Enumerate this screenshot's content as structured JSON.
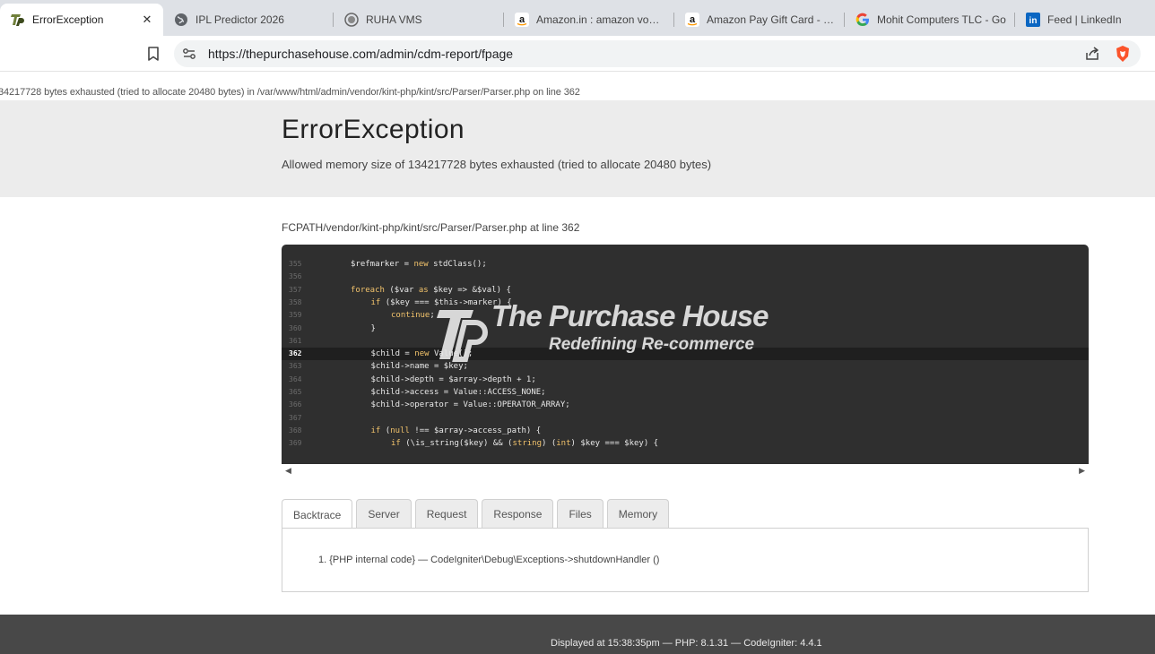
{
  "browser": {
    "tabs": [
      {
        "title": "ErrorException",
        "icon": "purchase-house-favicon-icon",
        "active": true
      },
      {
        "title": "IPL Predictor 2026",
        "icon": "globe-icon"
      },
      {
        "title": "RUHA VMS",
        "icon": "ruha-favicon-icon"
      },
      {
        "title": "Amazon.in : amazon vouch",
        "icon": "amazon-icon"
      },
      {
        "title": "Amazon Pay Gift Card - Fo",
        "icon": "amazon-icon"
      },
      {
        "title": "Mohit Computers TLC - Go",
        "icon": "google-icon"
      },
      {
        "title": "Feed | LinkedIn",
        "icon": "linkedin-icon"
      }
    ],
    "url": "https://thepurchasehouse.com/admin/cdm-report/fpage"
  },
  "error": {
    "top_message": "34217728 bytes exhausted (tried to allocate 20480 bytes) in /var/www/html/admin/vendor/kint-php/kint/src/Parser/Parser.php on line 362",
    "title": "ErrorException",
    "message": "Allowed memory size of 134217728 bytes exhausted (tried to allocate 20480 bytes)",
    "file": "FCPATH/vendor/kint-php/kint/src/Parser/Parser.php at line 362"
  },
  "code": {
    "highlight_line": 362,
    "lines": [
      {
        "n": "355",
        "indent": 0,
        "text": "$refmarker = new stdClass();"
      },
      {
        "n": "356",
        "indent": 0,
        "text": ""
      },
      {
        "n": "357",
        "indent": 0,
        "text": "foreach ($var as $key => &$val) {"
      },
      {
        "n": "358",
        "indent": 1,
        "text": "if ($key === $this->marker) {"
      },
      {
        "n": "359",
        "indent": 2,
        "text": "continue;"
      },
      {
        "n": "360",
        "indent": 1,
        "text": "}"
      },
      {
        "n": "361",
        "indent": 0,
        "text": ""
      },
      {
        "n": "362",
        "indent": 1,
        "text": "$child = new Value();"
      },
      {
        "n": "363",
        "indent": 1,
        "text": "$child->name = $key;"
      },
      {
        "n": "364",
        "indent": 1,
        "text": "$child->depth = $array->depth + 1;"
      },
      {
        "n": "365",
        "indent": 1,
        "text": "$child->access = Value::ACCESS_NONE;"
      },
      {
        "n": "366",
        "indent": 1,
        "text": "$child->operator = Value::OPERATOR_ARRAY;"
      },
      {
        "n": "367",
        "indent": 0,
        "text": ""
      },
      {
        "n": "368",
        "indent": 1,
        "text": "if (null !== $array->access_path) {"
      },
      {
        "n": "369",
        "indent": 2,
        "text": "if (\\is_string($key) && (string) (int) $key === $key) {"
      }
    ]
  },
  "watermark": {
    "title": "The Purchase House",
    "tagline": "Redefining Re-commerce"
  },
  "panel_tabs": [
    "Backtrace",
    "Server",
    "Request",
    "Response",
    "Files",
    "Memory"
  ],
  "active_panel_tab": "Backtrace",
  "backtrace": [
    "1. {PHP internal code}   —  CodeIgniter\\Debug\\Exceptions->shutdownHandler ()"
  ],
  "footer": "Displayed at 15:38:35pm — PHP: 8.1.31 — CodeIgniter: 4.4.1",
  "colors": {
    "code_bg": "#2f2f2f",
    "code_highlight_bg": "#1f1f1f",
    "keyword": "#f1c26b",
    "header_band": "#ececec",
    "footer_bg": "#484848",
    "brave_orange": "#fb542b",
    "linkedin_blue": "#0a66c2"
  }
}
